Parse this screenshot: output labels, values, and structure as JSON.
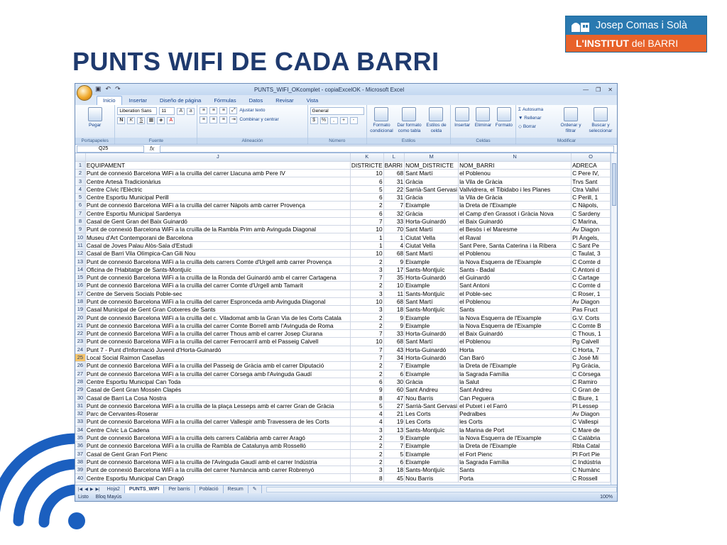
{
  "slide": {
    "title": "PUNTS WIFI DE CADA BARRI",
    "logo_line1": "Josep Comas i Solà",
    "logo_line2a": "L'INSTITUT",
    "logo_line2b": "del BARRI"
  },
  "excel": {
    "window_title": "PUNTS_WIFI_OKcomplet - copiaExcelOK - Microsoft Excel",
    "tabs": [
      "Inicio",
      "Insertar",
      "Diseño de página",
      "Fórmulas",
      "Datos",
      "Revisar",
      "Vista"
    ],
    "ribbon": {
      "paste": "Pegar",
      "font_name": "Liberation Sans",
      "font_size": "11",
      "wrap_text": "Ajustar texto",
      "merge_center": "Combinar y centrar",
      "number_format": "General",
      "cond_format": "Formato condicional",
      "format_table": "Dar formato como tabla",
      "cell_styles": "Estilos de celda",
      "insert": "Insertar",
      "delete": "Eliminar",
      "format": "Formato",
      "autosum": "Autosuma",
      "fill": "Rellenar",
      "clear": "Borrar",
      "sort_filter": "Ordenar y filtrar",
      "find_select": "Buscar y seleccionar",
      "groups": [
        "Portapapeles",
        "Fuente",
        "Alineación",
        "Número",
        "Estilos",
        "Celdas",
        "Modificar"
      ]
    },
    "name_box": "Q25",
    "fx": "fx",
    "columns": [
      "J",
      "K",
      "L",
      "M",
      "N",
      "O"
    ],
    "header_row": [
      "EQUIPAMENT",
      "DISTRICTE",
      "BARRI",
      "NOM_DISTRICTE",
      "NOM_BARRI",
      "ADRECA"
    ],
    "rows": [
      [
        "Punt de connexió Barcelona WiFi a la cruïlla del carrer Llacuna amb Pere IV",
        "10",
        "68",
        "Sant Martí",
        "el Poblenou",
        "C Pere IV,"
      ],
      [
        "Centre Artesà Tradicionàrius",
        "6",
        "31",
        "Gràcia",
        "la Vila de Gràcia",
        "Trvs Sant"
      ],
      [
        "Centre Cívic l'Elèctric",
        "5",
        "22",
        "Sarrià-Sant Gervasi",
        "Vallvidrera, el Tibidabo i les Planes",
        "Ctra Vallvi"
      ],
      [
        "Centre Esportiu Municipal Perill",
        "6",
        "31",
        "Gràcia",
        "la Vila de Gràcia",
        "C Perill, 1"
      ],
      [
        "Punt de connexió Barcelona WiFi a la cruïlla del carrer Nàpols amb carrer Provença",
        "2",
        "7",
        "Eixample",
        "la Dreta de l'Eixample",
        "C Nàpols,"
      ],
      [
        "Centre Esportiu Municipal Sardenya",
        "6",
        "32",
        "Gràcia",
        "el Camp d'en Grassot i Gràcia Nova",
        "C Sardeny"
      ],
      [
        "Casal de Gent Gran del Baix Guinardó",
        "7",
        "33",
        "Horta-Guinardó",
        "el Baix Guinardó",
        "C Marina,"
      ],
      [
        "Punt de connexió Barcelona WiFi a la cruïlla de la Rambla Prim amb Avinguda Diagonal",
        "10",
        "70",
        "Sant Martí",
        "el Besòs i el Maresme",
        "Av Diagon"
      ],
      [
        "Museu d'Art Contemporani de Barcelona",
        "1",
        "1",
        "Ciutat Vella",
        "el Raval",
        "Pl Àngels,"
      ],
      [
        "Casal de Joves Palau Alòs-Sala d'Estudi",
        "1",
        "4",
        "Ciutat Vella",
        "Sant Pere, Santa Caterina i la Ribera",
        "C Sant Pe"
      ],
      [
        "Casal de Barri Vila Olímpica-Can Gili Nou",
        "10",
        "68",
        "Sant Martí",
        "el Poblenou",
        "C Taulat, 3"
      ],
      [
        "Punt de connexió Barcelona WiFi a la cruïlla dels carrers Comte d'Urgell amb carrer Provença",
        "2",
        "9",
        "Eixample",
        "la Nova Esquerra de l'Eixample",
        "C Comte d"
      ],
      [
        "Oficina de l'Habitatge de Sants-Montjuïc",
        "3",
        "17",
        "Sants-Montjuïc",
        "Sants - Badal",
        "C Antoni d"
      ],
      [
        "Punt de connexió Barcelona WiFi a la cruïlla de la Ronda del Guinardó amb el carrer Cartagena",
        "7",
        "35",
        "Horta-Guinardó",
        "el Guinardó",
        "C Cartage"
      ],
      [
        "Punt de connexió Barcelona WiFi a la cruïlla del carrer Comte d'Urgell amb Tamarit",
        "2",
        "10",
        "Eixample",
        "Sant Antoni",
        "C Comte d"
      ],
      [
        "Centre de Serveis Socials Poble-sec",
        "3",
        "11",
        "Sants-Montjuïc",
        "el Poble-sec",
        "C Roser, 1"
      ],
      [
        "Punt de connexió Barcelona WiFi a la cruïlla del carrer Espronceda amb Avinguda Diagonal",
        "10",
        "68",
        "Sant Martí",
        "el Poblenou",
        "Av Diagon"
      ],
      [
        "Casal Municipal de Gent Gran Cotxeres de Sants",
        "3",
        "18",
        "Sants-Montjuïc",
        "Sants",
        "Pas Fruct"
      ],
      [
        "Punt de connexió Barcelona WiFi a la cruïlla del c. Viladomat amb la Gran Via de les Corts Catala",
        "2",
        "9",
        "Eixample",
        "la Nova Esquerra de l'Eixample",
        "G.V. Corts"
      ],
      [
        "Punt de connexió Barcelona WiFi a la cruïlla del carrer Comte Borrell amb l'Avinguda de Roma",
        "2",
        "9",
        "Eixample",
        "la Nova Esquerra de l'Eixample",
        "C Comte B"
      ],
      [
        "Punt de connexió Barcelona WiFi a la cruïlla del carrer Thous amb el carrer Josep Ciurana",
        "7",
        "33",
        "Horta-Guinardó",
        "el Baix Guinardó",
        "C Thous, 1"
      ],
      [
        "Punt de connexió Barcelona WiFi a la cruïlla del carrer Ferrocarril amb el Passeig Calvell",
        "10",
        "68",
        "Sant Martí",
        "el Poblenou",
        "Pg Calvell"
      ],
      [
        "Punt 7 - Punt d'Informació Juvenil d'Horta-Guinardó",
        "7",
        "43",
        "Horta-Guinardó",
        "Horta",
        "C Horta, 7"
      ],
      [
        "Local Social Raimon Casellas",
        "7",
        "34",
        "Horta-Guinardó",
        "Can Baró",
        "C José Mi"
      ],
      [
        "Punt de connexió Barcelona WiFi a la cruïlla del Passeig de Gràcia amb el carrer Diputació",
        "2",
        "7",
        "Eixample",
        "la Dreta de l'Eixample",
        "Pg Gràcia,"
      ],
      [
        "Punt de connexió Barcelona WiFi a la cruïlla del carrer Còrsega amb l'Avinguda Gaudí",
        "2",
        "6",
        "Eixample",
        "la Sagrada Família",
        "C Còrsega"
      ],
      [
        "Centre Esportiu Municipal Can Toda",
        "6",
        "30",
        "Gràcia",
        "la Salut",
        "C Ramiro"
      ],
      [
        "Casal de Gent Gran Mossèn Clapés",
        "9",
        "60",
        "Sant Andreu",
        "Sant Andreu",
        "C Gran de"
      ],
      [
        "Casal de Barri La Cosa Nostra",
        "8",
        "47",
        "Nou Barris",
        "Can Peguera",
        "C Biure, 1"
      ],
      [
        "Punt de connexió Barcelona WiFi a la cruïlla de la plaça Lesseps amb el carrer Gran de Gràcia",
        "5",
        "27",
        "Sarrià-Sant Gervasi",
        "el Putxet i el Farró",
        "Pl Lessep"
      ],
      [
        "Parc de Cervantes-Roserar",
        "4",
        "21",
        "Les Corts",
        "Pedralbes",
        "Av Diagon"
      ],
      [
        "Punt de connexió Barcelona WiFi a la cruïlla del carrer Vallespir amb Travessera de les Corts",
        "4",
        "19",
        "Les Corts",
        "les Corts",
        "C Vallespi"
      ],
      [
        "Centre Cívic La Cadena",
        "3",
        "13",
        "Sants-Montjuïc",
        "la Marina de Port",
        "C Mare de"
      ],
      [
        "Punt de connexió Barcelona WiFi a la cruïlla dels carrers Calàbria amb carrer Aragó",
        "2",
        "9",
        "Eixample",
        "la Nova Esquerra de l'Eixample",
        "C Calàbria"
      ],
      [
        "Punt de connexió Barcelona WiFi a la cruïlla de Rambla de Catalunya amb Rosselló",
        "2",
        "7",
        "Eixample",
        "la Dreta de l'Eixample",
        "Rbla Catal"
      ],
      [
        "Casal de Gent Gran Fort Pienc",
        "2",
        "5",
        "Eixample",
        "el Fort Pienc",
        "Pl Fort Pie"
      ],
      [
        "Punt de connexió Barcelona WiFi a la cruïlla de l'Avinguda Gaudí amb el carrer Indústria",
        "2",
        "6",
        "Eixample",
        "la Sagrada Família",
        "C Indústria"
      ],
      [
        "Punt de connexió Barcelona WiFi a la cruïlla del carrer Numància amb carrer Robrenyó",
        "3",
        "18",
        "Sants-Montjuïc",
        "Sants",
        "C Numànc"
      ],
      [
        "Centre Esportiu Municipal Can Dragó",
        "8",
        "45",
        "Nou Barris",
        "Porta",
        "C Rossell"
      ]
    ],
    "sheet_tabs": [
      "Hoja2",
      "PUNTS_WIFI",
      "Per barris",
      "Població",
      "Resum"
    ],
    "active_tab": "PUNTS_WIFI",
    "status_left": "Listo",
    "status_second": "Bloq Mayús",
    "zoom": "100%"
  }
}
